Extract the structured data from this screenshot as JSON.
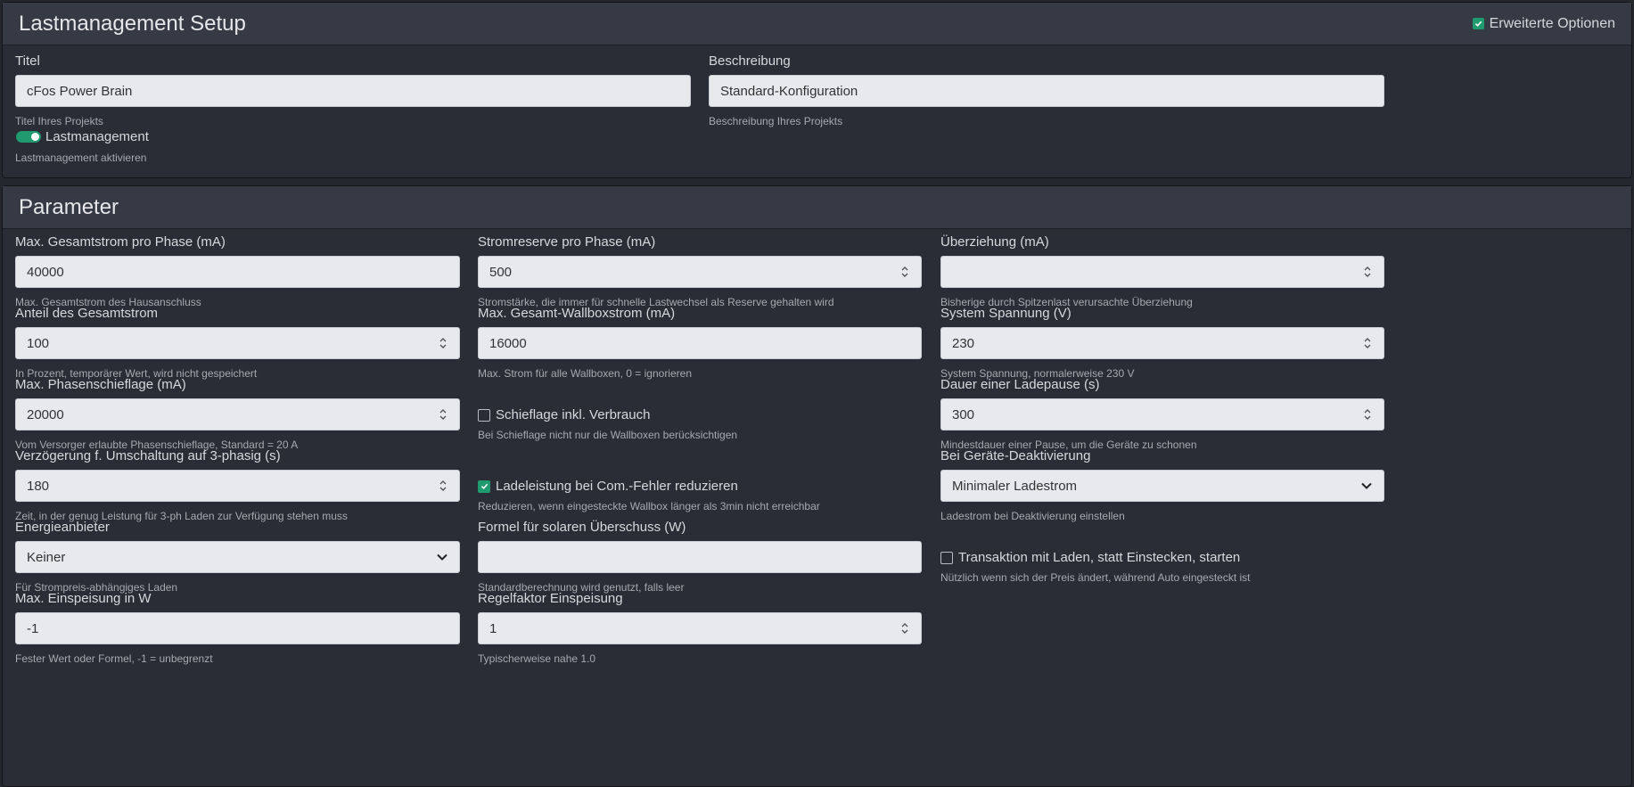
{
  "setup": {
    "title": "Lastmanagement Setup",
    "advanced_label": "Erweiterte Optionen",
    "advanced_checked": true,
    "titel": {
      "label": "Titel",
      "value": "cFos Power Brain",
      "help": "Titel Ihres Projekts"
    },
    "beschreibung": {
      "label": "Beschreibung",
      "value": "Standard-Konfiguration",
      "help": "Beschreibung Ihres Projekts"
    },
    "lastmanagement": {
      "label": "Lastmanagement",
      "help": "Lastmanagement aktivieren",
      "enabled": true
    }
  },
  "params": {
    "title": "Parameter",
    "max_gesamtstrom": {
      "label": "Max. Gesamtstrom pro Phase (mA)",
      "value": "40000",
      "help": "Max. Gesamtstrom des Hausanschluss"
    },
    "stromreserve": {
      "label": "Stromreserve pro Phase (mA)",
      "value": "500",
      "help": "Stromstärke, die immer für schnelle Lastwechsel als Reserve gehalten wird"
    },
    "ueberziehung": {
      "label": "Überziehung (mA)",
      "value": "",
      "help": "Bisherige durch Spitzenlast verursachte Überziehung"
    },
    "anteil": {
      "label": "Anteil des Gesamtstrom",
      "value": "100",
      "help": "In Prozent, temporärer Wert, wird nicht gespeichert"
    },
    "max_wallbox": {
      "label": "Max. Gesamt-Wallboxstrom (mA)",
      "value": "16000",
      "help": "Max. Strom für alle Wallboxen, 0 = ignorieren"
    },
    "spannung": {
      "label": "System Spannung (V)",
      "value": "230",
      "help": "System Spannung, normalerweise 230 V"
    },
    "schieflage": {
      "label": "Max. Phasenschieflage (mA)",
      "value": "20000",
      "help": "Vom Versorger erlaubte Phasenschieflage, Standard = 20 A"
    },
    "schieflage_verbrauch": {
      "label": "Schieflage inkl. Verbrauch",
      "checked": false,
      "help": "Bei Schieflage nicht nur die Wallboxen berücksichtigen"
    },
    "ladepause": {
      "label": "Dauer einer Ladepause (s)",
      "value": "300",
      "help": "Mindestdauer einer Pause, um die Geräte zu schonen"
    },
    "verzoegerung": {
      "label": "Verzögerung f. Umschaltung auf 3-phasig (s)",
      "value": "180",
      "help": "Zeit, in der genug Leistung für 3-ph Laden zur Verfügung stehen muss"
    },
    "com_fehler": {
      "label": "Ladeleistung bei Com.-Fehler reduzieren",
      "checked": true,
      "help": "Reduzieren, wenn eingesteckte Wallbox länger als 3min nicht erreichbar"
    },
    "deaktivierung": {
      "label": "Bei Geräte-Deaktivierung",
      "value": "Minimaler Ladestrom",
      "help": "Ladestrom bei Deaktivierung einstellen"
    },
    "energieanbieter": {
      "label": "Energieanbieter",
      "value": "Keiner",
      "help": "Für Strompreis-abhängiges Laden"
    },
    "formel": {
      "label": "Formel für solaren Überschuss (W)",
      "value": "",
      "help": "Standardberechnung wird genutzt, falls leer"
    },
    "transaktion": {
      "label": "Transaktion mit Laden, statt Einstecken, starten",
      "checked": false,
      "help": "Nützlich wenn sich der Preis ändert, während Auto eingesteckt ist"
    },
    "einspeisung": {
      "label": "Max. Einspeisung in W",
      "value": "-1",
      "help": "Fester Wert oder Formel, -1 = unbegrenzt"
    },
    "regelfaktor": {
      "label": "Regelfaktor Einspeisung",
      "value": "1",
      "help": "Typischerweise nahe 1.0"
    }
  }
}
